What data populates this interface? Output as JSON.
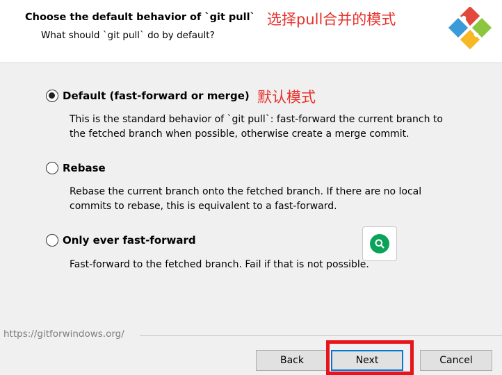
{
  "header": {
    "title": "Choose the default behavior of `git pull`",
    "subtitle": "What should `git pull` do by default?",
    "annotation": "选择pull合并的模式"
  },
  "options": [
    {
      "label": "Default (fast-forward or merge)",
      "checked": true,
      "annotation": "默认模式",
      "description": [
        "This is the standard behavior of `git pull`: fast-forward the current branch to",
        "the fetched branch when possible, otherwise create a merge commit."
      ]
    },
    {
      "label": "Rebase",
      "checked": false,
      "description": [
        "Rebase the current branch onto the fetched branch. If there are no local",
        "commits to rebase, this is equivalent to a fast-forward."
      ]
    },
    {
      "label": "Only ever fast-forward",
      "checked": false,
      "description": [
        "Fast-forward to the fetched branch. Fail if that is not possible."
      ]
    }
  ],
  "footer": {
    "url": "https://gitforwindows.org/",
    "back_label": "Back",
    "next_label": "Next",
    "cancel_label": "Cancel"
  },
  "icons": {
    "logo": "git-logo-icon",
    "search": "search-icon"
  },
  "colors": {
    "annotation_red": "#e8302a",
    "highlight_red": "#e8141b",
    "search_green": "#0ba25a",
    "focus_blue": "#0078d7"
  }
}
